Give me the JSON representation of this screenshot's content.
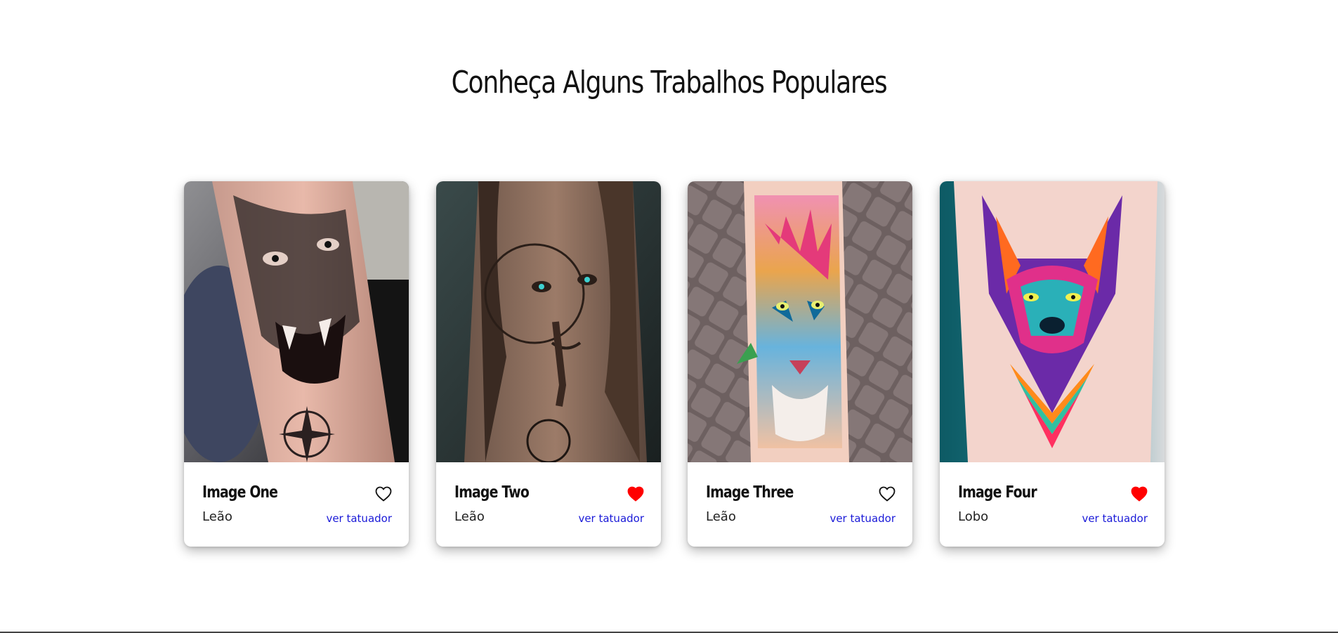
{
  "section": {
    "title": "Conheça Alguns Trabalhos Populares"
  },
  "cards": [
    {
      "title": "Image One",
      "subtitle": "Leão",
      "link_label": "ver tatuador",
      "favorited": false,
      "image_subject": "tiger-tattoo"
    },
    {
      "title": "Image Two",
      "subtitle": "Leão",
      "link_label": "ver tatuador",
      "favorited": true,
      "image_subject": "woman-clock-tattoo"
    },
    {
      "title": "Image Three",
      "subtitle": "Leão",
      "link_label": "ver tatuador",
      "favorited": false,
      "image_subject": "colorful-lion-tattoo"
    },
    {
      "title": "Image Four",
      "subtitle": "Lobo",
      "link_label": "ver tatuador",
      "favorited": true,
      "image_subject": "colorful-wolf-tattoo"
    }
  ],
  "colors": {
    "link": "#1a1ad8",
    "favorite_active": "#ff0000",
    "favorite_inactive": "#111111"
  },
  "icons": {
    "favorite": "heart-icon"
  }
}
